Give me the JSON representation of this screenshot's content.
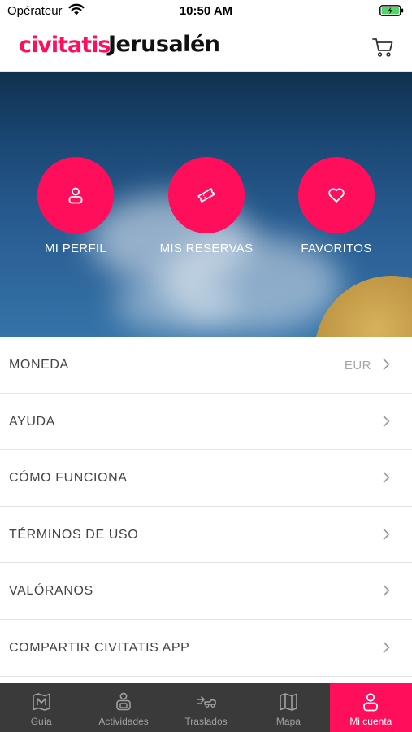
{
  "status_bar": {
    "carrier": "Opérateur",
    "time": "10:50 AM"
  },
  "header": {
    "brand": "civitatis",
    "city": "Jerusalén",
    "brand_color": "#ff0f5b"
  },
  "hero": {
    "actions": [
      {
        "label": "MI PERFIL",
        "icon": "user-icon"
      },
      {
        "label": "MIS RESERVAS",
        "icon": "ticket-icon"
      },
      {
        "label": "FAVORITOS",
        "icon": "heart-icon"
      }
    ]
  },
  "settings": [
    {
      "label": "MONEDA",
      "value": "EUR"
    },
    {
      "label": "AYUDA"
    },
    {
      "label": "CÓMO FUNCIONA"
    },
    {
      "label": "TÉRMINOS DE USO"
    },
    {
      "label": "VALÓRANOS"
    },
    {
      "label": "COMPARTIR CIVITATIS APP"
    }
  ],
  "tabs": [
    {
      "label": "Guía",
      "icon": "map-book-icon",
      "active": false
    },
    {
      "label": "Actividades",
      "icon": "activities-icon",
      "active": false
    },
    {
      "label": "Traslados",
      "icon": "transfers-icon",
      "active": false
    },
    {
      "label": "Mapa",
      "icon": "map-icon",
      "active": false
    },
    {
      "label": "Mi cuenta",
      "icon": "account-icon",
      "active": true
    }
  ],
  "colors": {
    "accent": "#ff0f5b",
    "tab_bar": "#3a3a3a",
    "tab_inactive_text": "#a0a0a0",
    "list_text": "#444444"
  }
}
